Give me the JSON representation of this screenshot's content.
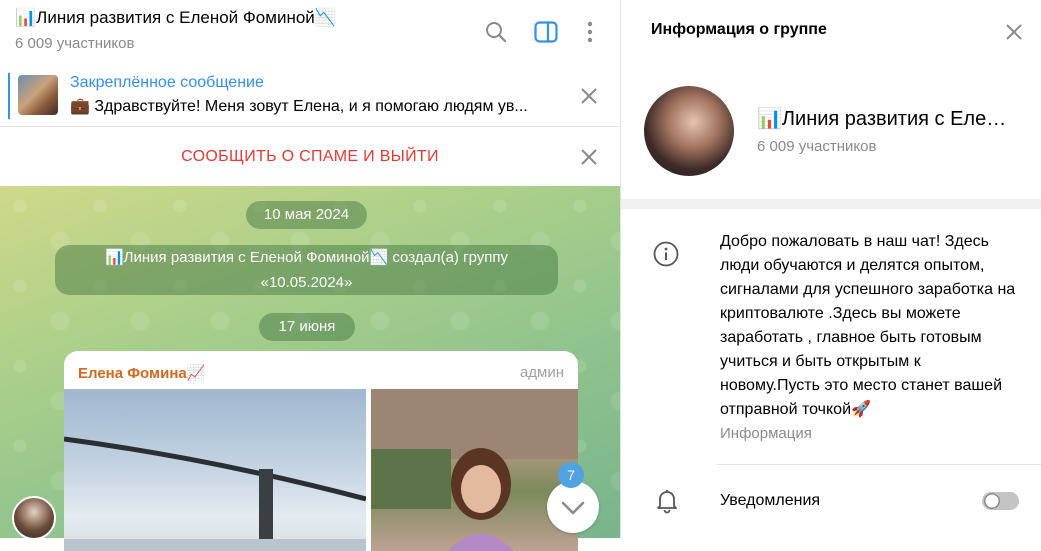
{
  "chat": {
    "title": "📊Линия развития с Еленой Фоминой📉",
    "subtitle": "6 009 участников",
    "pinned": {
      "title": "Закреплённое сообщение",
      "text": "💼 Здравствуйте! Меня зовут Елена, и я помогаю людям ув..."
    },
    "spam_label": "СООБЩИТЬ О СПАМЕ И ВЫЙТИ",
    "date1": "10 мая 2024",
    "service_line1": "📊Линия развития с Еленой Фоминой📉 создал(а) группу",
    "service_line2": "«10.05.2024»",
    "date2": "17 июня",
    "message": {
      "author": "Елена Фомина📈",
      "role": "админ"
    },
    "unread_count": "7"
  },
  "info": {
    "title": "Информация о группе",
    "name": "📊Линия развития с Еле…",
    "count": "6 009 участников",
    "description": "Добро пожаловать в наш чат! Здесь люди обучаются и делятся опытом, сигналами для успешного заработка на криптовалюте .Здесь вы можете заработать , главное быть готовым учиться и быть открытым к новому.Пусть это место станет вашей отправной точкой🚀",
    "description_label": "Информация",
    "notifications_label": "Уведомления",
    "notifications_on": false
  },
  "colors": {
    "accent": "#3390ec",
    "danger": "#e53935",
    "author": "#d2691e"
  }
}
